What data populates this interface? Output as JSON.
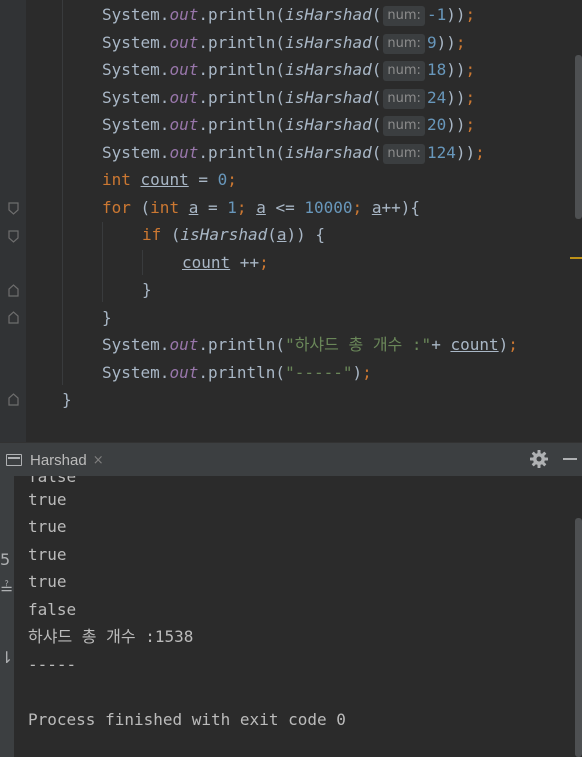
{
  "editor": {
    "tokens": {
      "system": "System",
      "out": "out",
      "println": "println",
      "isHarshad": "isHarshad",
      "hint_num": "num:",
      "int_kw": "int",
      "for_kw": "for",
      "if_kw": "if",
      "count": "count",
      "a": "a",
      "zero": "0",
      "one": "1",
      "limit": "10000",
      "str_total": "\"하샤드 총 개수 :\"",
      "str_dashes": "\"-----\""
    },
    "calls": [
      {
        "arg": "-1"
      },
      {
        "arg": "9"
      },
      {
        "arg": "18"
      },
      {
        "arg": "24"
      },
      {
        "arg": "20"
      },
      {
        "arg": "124"
      }
    ]
  },
  "run_panel": {
    "tab_label": "Harshad",
    "close_glyph": "×",
    "settings_icon": "gear-icon",
    "minimize_icon": "minimize-icon"
  },
  "console": {
    "partial_top": "false",
    "lines": [
      "true",
      "true",
      "true",
      "true",
      "false",
      "하샤드 총 개수 :1538",
      "-----",
      ""
    ],
    "exit_message": "Process finished with exit code 0",
    "toolbar_glyphs": [
      "5",
      "≟",
      "⇂"
    ]
  },
  "colors": {
    "background": "#2b2b2b",
    "keyword": "#cc7832",
    "static_field": "#9876aa",
    "number": "#6897bb",
    "string": "#6a8759",
    "text": "#a9b7c6",
    "panel": "#3c3f41"
  }
}
